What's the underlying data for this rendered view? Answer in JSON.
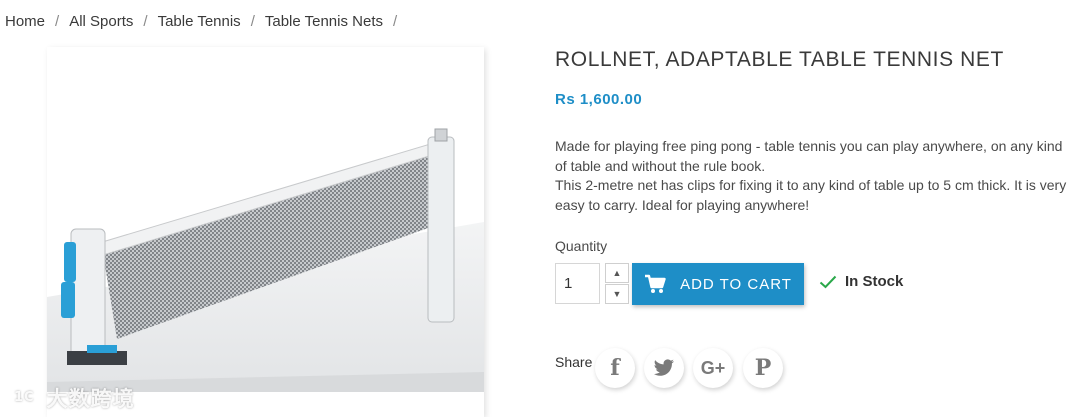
{
  "breadcrumb": {
    "items": [
      "Home",
      "All Sports",
      "Table Tennis",
      "Table Tennis Nets"
    ],
    "separator": "/"
  },
  "product": {
    "title": "ROLLNET, ADAPTABLE TABLE TENNIS NET",
    "price": "Rs 1,600.00",
    "description": [
      "Made for playing free ping pong - table tennis you can play anywhere, on any kind of table and without the rule book.",
      "This 2-metre net has clips for fixing it to any kind of table up to 5 cm thick. It is very easy to carry. Ideal for playing anywhere!"
    ],
    "image_icon": "table-tennis-net-image"
  },
  "purchase": {
    "quantity_label": "Quantity",
    "quantity_value": "1",
    "stepper_up_icon": "chevron-up-icon",
    "stepper_down_icon": "chevron-down-icon",
    "add_to_cart_label": "ADD TO CART",
    "cart_icon": "shopping-cart-icon",
    "stock_status": "In Stock",
    "stock_icon": "checkmark-icon"
  },
  "share": {
    "label": "Share",
    "buttons": [
      {
        "name": "facebook",
        "glyph": "f",
        "icon": "facebook-icon"
      },
      {
        "name": "twitter",
        "glyph": "",
        "icon": "twitter-icon"
      },
      {
        "name": "google-plus",
        "glyph": "G+",
        "icon": "google-plus-icon"
      },
      {
        "name": "pinterest",
        "glyph": "P",
        "icon": "pinterest-icon"
      }
    ]
  },
  "watermark": {
    "text": "大数跨境",
    "mark": "1C"
  },
  "colors": {
    "accent": "#1e8ec7",
    "stock_check": "#2aa84a",
    "text": "#3a3a3a"
  }
}
